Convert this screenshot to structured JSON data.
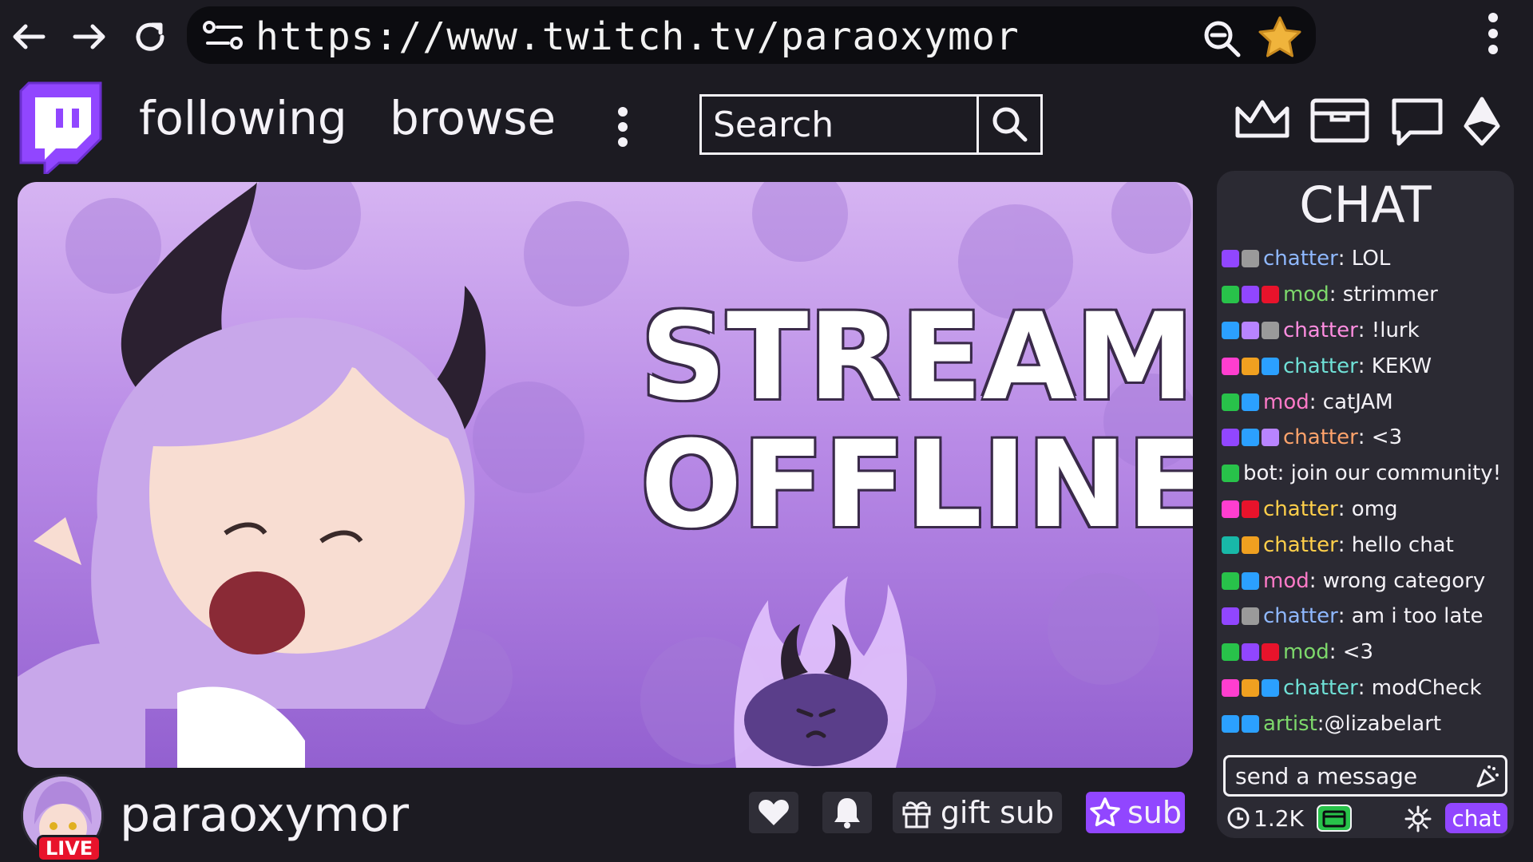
{
  "browser": {
    "url": "https://www.twitch.tv/paraoxymor",
    "icons": [
      "back-arrow-icon",
      "forward-arrow-icon",
      "reload-icon",
      "tune-icon",
      "zoom-out-icon",
      "star-icon",
      "kebab-icon"
    ]
  },
  "header": {
    "nav": [
      "following",
      "browse"
    ],
    "search_placeholder": "Search",
    "icons": [
      "crown-icon",
      "inbox-icon",
      "chat-bubble-icon",
      "bits-icon"
    ]
  },
  "player": {
    "offline_line1": "STREAM",
    "offline_line2": "OFFLINE"
  },
  "channel": {
    "name": "paraoxymor",
    "live_label": "LIVE",
    "gift_label": "gift sub",
    "sub_label": "sub"
  },
  "chat": {
    "title": "CHAT",
    "messages": [
      {
        "user": "chatter",
        "text": ": LOL",
        "color": "#8fb8ff",
        "badges": [
          "#9146ff",
          "#9a9a9a"
        ]
      },
      {
        "user": "mod",
        "text": ": strimmer",
        "color": "#7dd86b",
        "badges": [
          "#28c24a",
          "#9146ff",
          "#e8132b"
        ]
      },
      {
        "user": "chatter",
        "text": ": !lurk",
        "color": "#ff8de0",
        "badges": [
          "#2ba0ff",
          "#b884ff",
          "#9a9a9a"
        ]
      },
      {
        "user": "chatter",
        "text": ": KEKW",
        "color": "#6fe0d6",
        "badges": [
          "#ff3ecf",
          "#f0a020",
          "#2ba0ff"
        ]
      },
      {
        "user": "mod",
        "text": ": catJAM",
        "color": "#ff7ac8",
        "badges": [
          "#28c24a",
          "#2ba0ff"
        ]
      },
      {
        "user": "chatter",
        "text": ": <3",
        "color": "#ffa36b",
        "badges": [
          "#9146ff",
          "#2ba0ff",
          "#b884ff"
        ]
      },
      {
        "user": "bot",
        "text": ": join our community!",
        "color": "#f4f2f7",
        "badges": [
          "#28c24a"
        ]
      },
      {
        "user": "chatter",
        "text": ": omg",
        "color": "#ffcf4a",
        "badges": [
          "#ff3ecf",
          "#e8132b"
        ]
      },
      {
        "user": "chatter",
        "text": ": hello chat",
        "color": "#ffcf4a",
        "badges": [
          "#18b8a8",
          "#f0a020"
        ]
      },
      {
        "user": "mod",
        "text": ": wrong category",
        "color": "#ff7ac8",
        "badges": [
          "#28c24a",
          "#2ba0ff"
        ]
      },
      {
        "user": "chatter",
        "text": ": am i too late",
        "color": "#8fb8ff",
        "badges": [
          "#9146ff",
          "#9a9a9a"
        ]
      },
      {
        "user": "mod",
        "text": ": <3",
        "color": "#7dd86b",
        "badges": [
          "#28c24a",
          "#9146ff",
          "#e8132b"
        ]
      },
      {
        "user": "chatter",
        "text": ": modCheck",
        "color": "#6fe0d6",
        "badges": [
          "#ff3ecf",
          "#f0a020",
          "#2ba0ff"
        ]
      },
      {
        "user": "artist",
        "text": ":@lizabelart",
        "color": "#7dd86b",
        "badges": [
          "#2ba0ff",
          "#2ba0ff"
        ]
      }
    ],
    "input_placeholder": "send a message",
    "viewer_count": "1.2K",
    "chat_button": "chat"
  },
  "colors": {
    "accent": "#9146ff",
    "live": "#e8132b",
    "points": "#28c24a"
  }
}
